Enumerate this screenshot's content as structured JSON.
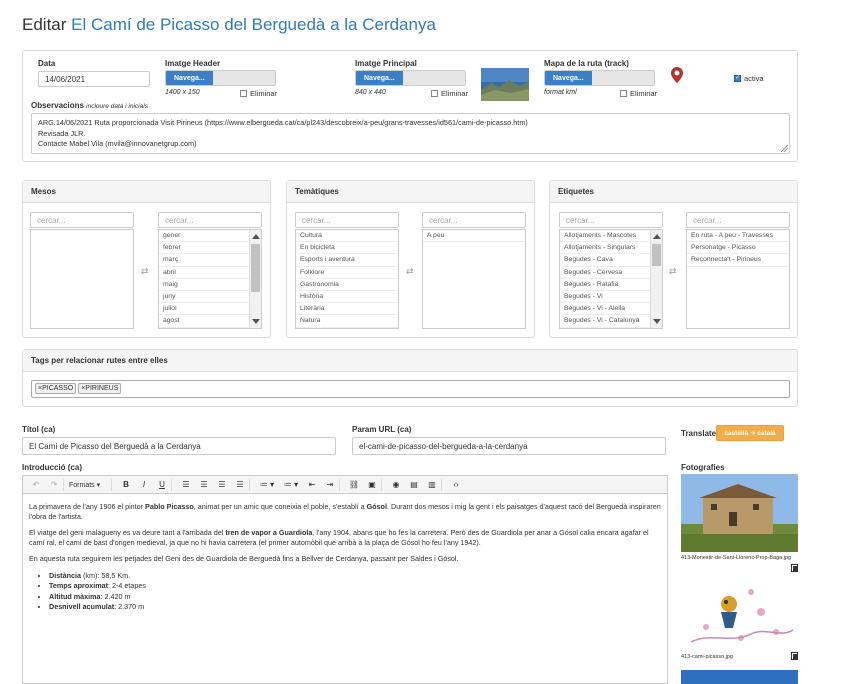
{
  "title": {
    "prefix": "Editar",
    "route": "El Camí de Picasso del Berguedà a la Cerdanya"
  },
  "top": {
    "date_label": "Data",
    "date_value": "14/06/2021",
    "header_label": "Imatge Header",
    "header_btn": "Navega...",
    "header_size": "1400 x 150",
    "principal_label": "Imatge Principal",
    "principal_btn": "Navega...",
    "principal_size": "840 x 440",
    "track_label": "Mapa de la ruta (track)",
    "track_btn": "Navega...",
    "track_hint": "format kml",
    "delete_label": "Eliminar",
    "active_label": "activa",
    "obs_label": "Observacions",
    "obs_hint": "incloure data i inicials",
    "obs_lines": [
      "ARG.14/06/2021 Ruta proporcionada Visit Pirineus (https://www.elbergueda.cat/ca/pl243/descobreix/a-peu/grans-travesses/id561/cami-de-picasso.htm)",
      "Revisada JLR.",
      "Contacte Mabel Vila (mvila@innovanetgrup.com)"
    ]
  },
  "search_placeholder": "cercar...",
  "mesos": {
    "title": "Mesos",
    "available": [
      "gener",
      "febrer",
      "març",
      "abril",
      "maig",
      "juny",
      "juliol",
      "agost"
    ],
    "selected": []
  },
  "tematiques": {
    "title": "Temàtiques",
    "available": [
      "Cultura",
      "En bicicleta",
      "Esports i aventura",
      "Folklore",
      "Gastronomia",
      "Història",
      "Literària",
      "Natura"
    ],
    "selected": [
      "A peu"
    ]
  },
  "etiquetes": {
    "title": "Etiquetes",
    "available": [
      "Allotjaments - Mascotes",
      "Allotjaments - Singulars",
      "Begudes - Cava",
      "Begudes - Cervesa",
      "Begudes - Ratafia",
      "Begudes - Vi",
      "Begudes - Vi - Alella",
      "Begudes - Vi - Catalunya"
    ],
    "selected": [
      "En ruta - A peu - Travesses",
      "Personatge - Picasso",
      "Reconnecta't - Pirineus"
    ]
  },
  "tags": {
    "title": "Tags per relacionar rutes entre elles",
    "items": [
      "×PICASSO",
      "×PIRINEUS"
    ]
  },
  "fields": {
    "titol_label": "Títol (ca)",
    "titol_value": "El Camí de Picasso del Berguedà a la Cerdanya",
    "url_label": "Param URL (ca)",
    "url_value": "el-cami-de-picasso-del-bergueda-a-la-cerdanya",
    "intro_label": "Introducció (ca)",
    "translate_label": "Translate",
    "translate_btn": "castellà ➔ català",
    "photos_label": "Fotografies"
  },
  "toolbar": {
    "formats": "Formats"
  },
  "intro": {
    "p1_a": "La primavera de l'any 1906 el pintor ",
    "p1_b": "Pablo Picasso",
    "p1_c": ", animat per un amic que coneixia el poble, s'establí a ",
    "p1_d": "Gósol",
    "p1_e": ". Durant dos mesos i mig la gent i els paisatges d'aquest racó del Berguedà inspiraren l'obra de l'artista.",
    "p2_a": "El viatge del geni malagueny es va deure tant a l'arribada del ",
    "p2_b": "tren de vapor a Guardiola",
    "p2_c": ", l'any 1904, abans que ho fes la carretera. Però des de Guardiola per anar a Gósol calia encara agafar el camí ral, el camí de bast d'origen medieval, ja que no hi havia carretera (el primer automòbil que arribà a la plaça de Gósol ho feu l'any 1942).",
    "p3": "En aquesta ruta seguirem les petjades del Geni des de Guardiola de Berguedà fins a Bellver de Cerdanya, passant per Saldes  i Gósol.",
    "li": [
      {
        "k": "Distància",
        "v": " (km): 58,5 Km."
      },
      {
        "k": "Temps aproximat",
        "v": ": 2-4 etapes"
      },
      {
        "k": "Altitud màxima",
        "v": ": 2.420 m"
      },
      {
        "k": "Desnivell acumulat",
        "v": ": 2.370 m"
      }
    ]
  },
  "photos": [
    {
      "caption": "413-Monestir-de-Sant-Llorenc-Prop-Baga.jpg"
    },
    {
      "caption": "413-cami-picasso.jpg"
    }
  ]
}
